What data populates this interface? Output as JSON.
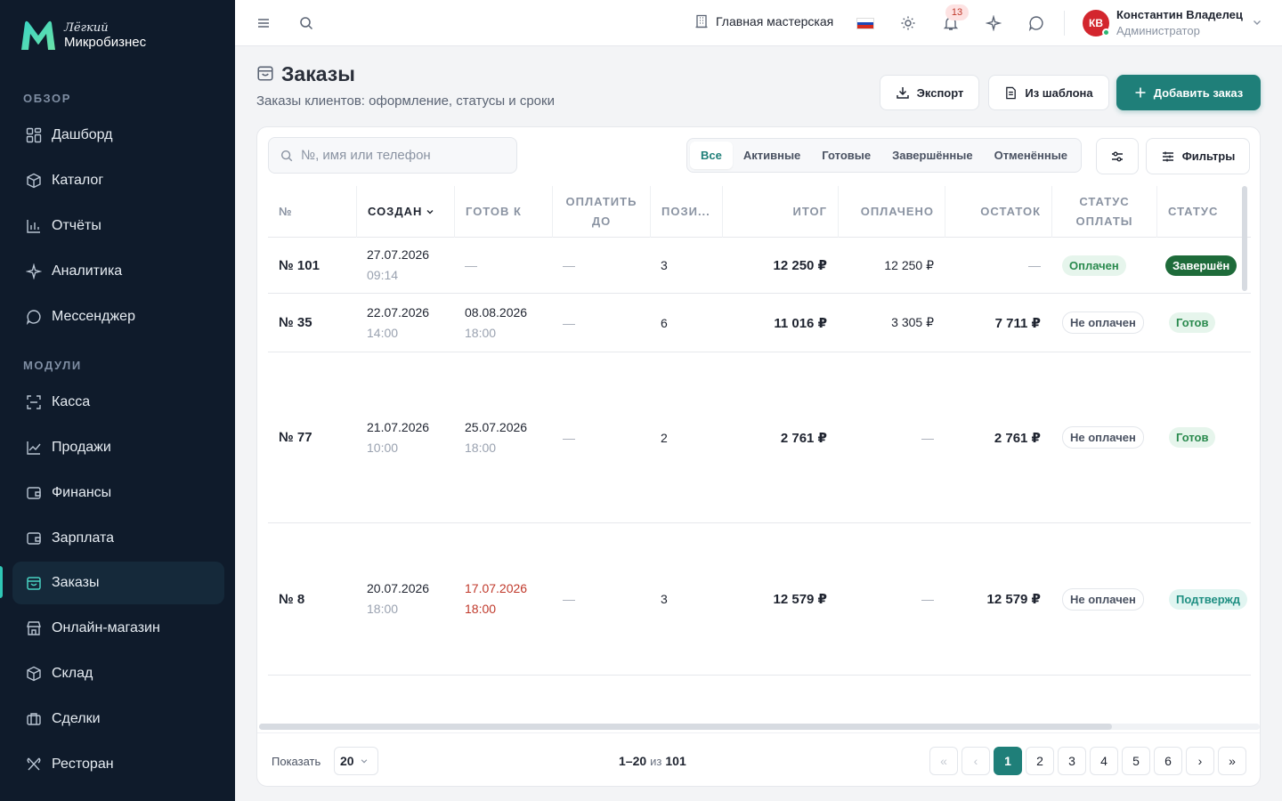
{
  "brand": {
    "line1": "Лёгкий",
    "line2": "Микробизнес"
  },
  "sidebar": {
    "sections": [
      "ОБЗОР",
      "МОДУЛИ"
    ],
    "items": [
      {
        "label": "Дашборд",
        "icon": "dashboard-icon"
      },
      {
        "label": "Каталог",
        "icon": "catalog-icon"
      },
      {
        "label": "Отчёты",
        "icon": "reports-icon"
      },
      {
        "label": "Аналитика",
        "icon": "analytics-icon"
      },
      {
        "label": "Мессенджер",
        "icon": "messenger-icon"
      },
      {
        "label": "Касса",
        "icon": "cashbox-icon"
      },
      {
        "label": "Продажи",
        "icon": "sales-icon"
      },
      {
        "label": "Финансы",
        "icon": "finance-icon"
      },
      {
        "label": "Зарплата",
        "icon": "salary-icon"
      },
      {
        "label": "Заказы",
        "icon": "orders-icon",
        "active": true
      },
      {
        "label": "Онлайн-магазин",
        "icon": "shop-icon"
      },
      {
        "label": "Склад",
        "icon": "warehouse-icon"
      },
      {
        "label": "Сделки",
        "icon": "deals-icon"
      },
      {
        "label": "Ресторан",
        "icon": "restaurant-icon"
      }
    ]
  },
  "topbar": {
    "workshop": "Главная мастерская",
    "notifications_count": "13",
    "user": {
      "initials": "КВ",
      "name": "Константин Владелец",
      "role": "Администратор"
    }
  },
  "page": {
    "title": "Заказы",
    "subtitle": "Заказы клиентов: оформление, статусы и сроки",
    "buttons": {
      "export": "Экспорт",
      "template": "Из шаблона",
      "add": "Добавить заказ"
    }
  },
  "toolbar": {
    "search_placeholder": "№, имя или телефон",
    "tabs": [
      "Все",
      "Активные",
      "Готовые",
      "Завершённые",
      "Отменённые"
    ],
    "filters": "Фильтры"
  },
  "table": {
    "columns": [
      "№",
      "СОЗДАН",
      "ГОТОВ К",
      "ОПЛАТИТЬ ДО",
      "ПОЗИ...",
      "ИТОГ",
      "ОПЛАЧЕНО",
      "ОСТАТОК",
      "СТАТУС ОПЛАТЫ",
      "СТАТУС"
    ],
    "rows": [
      {
        "num": "№ 101",
        "created_date": "27.07.2026",
        "created_time": "09:14",
        "ready": "—",
        "ready_time": "",
        "pay_by": "—",
        "positions": "3",
        "total": "12 250 ₽",
        "paid": "12 250 ₽",
        "rest": "—",
        "pay_status": "Оплачен",
        "status": "Завершён"
      },
      {
        "num": "№ 35",
        "created_date": "22.07.2026",
        "created_time": "14:00",
        "ready": "08.08.2026",
        "ready_time": "18:00",
        "pay_by": "—",
        "positions": "6",
        "total": "11 016 ₽",
        "paid": "3 305 ₽",
        "rest": "7 711 ₽",
        "pay_status": "Не оплачен",
        "status": "Готов"
      },
      {
        "num": "№ 77",
        "created_date": "21.07.2026",
        "created_time": "10:00",
        "ready": "25.07.2026",
        "ready_time": "18:00",
        "pay_by": "—",
        "positions": "2",
        "total": "2 761 ₽",
        "paid": "—",
        "rest": "2 761 ₽",
        "pay_status": "Не оплачен",
        "status": "Готов"
      },
      {
        "num": "№ 8",
        "created_date": "20.07.2026",
        "created_time": "18:00",
        "ready": "17.07.2026",
        "ready_time": "18:00",
        "pay_by": "—",
        "positions": "3",
        "total": "12 579 ₽",
        "paid": "—",
        "rest": "12 579 ₽",
        "pay_status": "Не оплачен",
        "status": "Подтвержд"
      }
    ]
  },
  "footer": {
    "show_label": "Показать",
    "page_size": "20",
    "range": "1–20",
    "of": "из",
    "total": "101",
    "pages": [
      "1",
      "2",
      "3",
      "4",
      "5",
      "6"
    ],
    "current_page": "1"
  },
  "colors": {
    "accent": "#1f7f79",
    "sidebar_bg": "#0f1b2b",
    "danger": "#c0392b"
  }
}
